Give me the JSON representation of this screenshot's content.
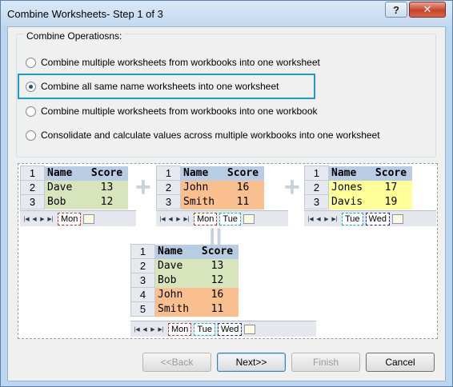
{
  "window": {
    "title": "Combine Worksheets- Step 1 of 3",
    "help_label": "?",
    "close_label": "✕"
  },
  "group": {
    "legend": "Combine Operatiosns:",
    "options": [
      {
        "label": "Combine multiple worksheets from workbooks into one worksheet",
        "selected": false
      },
      {
        "label": "Combine all same name worksheets into one worksheet",
        "selected": true
      },
      {
        "label": "Combine multiple worksheets from workbooks into one workbook",
        "selected": false
      },
      {
        "label": "Consolidate and calculate values across multiple workbooks into one worksheet",
        "selected": false
      }
    ]
  },
  "preview": {
    "header": {
      "name": "Name",
      "score": "Score"
    },
    "book1": {
      "rows": [
        {
          "num": "1"
        },
        {
          "num": "2",
          "name": "Dave",
          "score": "13"
        },
        {
          "num": "3",
          "name": "Bob",
          "score": "12"
        }
      ],
      "tabs": [
        "Mon"
      ]
    },
    "book2": {
      "rows": [
        {
          "num": "1"
        },
        {
          "num": "2",
          "name": "John",
          "score": "16"
        },
        {
          "num": "3",
          "name": "Smith",
          "score": "11"
        }
      ],
      "tabs": [
        "Mon",
        "Tue"
      ]
    },
    "book3": {
      "rows": [
        {
          "num": "1"
        },
        {
          "num": "2",
          "name": "Jones",
          "score": "17"
        },
        {
          "num": "3",
          "name": "Davis",
          "score": "19"
        }
      ],
      "tabs": [
        "Tue",
        "Wed"
      ]
    },
    "result": {
      "rows": [
        {
          "num": "1"
        },
        {
          "num": "2",
          "name": "Dave",
          "score": "13"
        },
        {
          "num": "3",
          "name": "Bob",
          "score": "12"
        },
        {
          "num": "4",
          "name": "John",
          "score": "16"
        },
        {
          "num": "5",
          "name": "Smith",
          "score": "11"
        }
      ],
      "tabs": [
        "Mon",
        "Tue",
        "Wed"
      ]
    },
    "nav_first": "|◀",
    "nav_prev": "◀",
    "nav_next": "▶",
    "nav_last": "▶|",
    "plus": "+",
    "equals": "||"
  },
  "buttons": {
    "back": "<<Back",
    "next": "Next>>",
    "finish": "Finish",
    "cancel": "Cancel"
  }
}
